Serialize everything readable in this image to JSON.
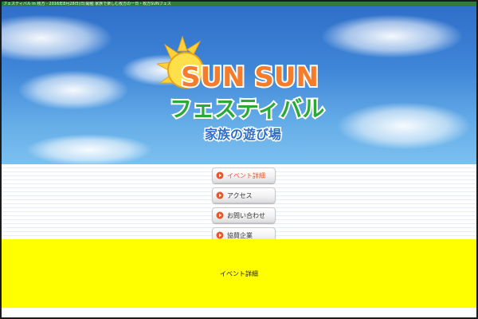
{
  "window": {
    "title": "フェスティバル in 枚方 - 2016年8月28日(日)開催 家族で楽しむ枚方の一日・枚方SUNフェス"
  },
  "logo": {
    "top_text": "SUN SUN",
    "middle_text": "フェスティバル",
    "bottom_text": "家族の遊び場"
  },
  "nav": {
    "items": [
      {
        "label": "イベント詳細",
        "active": true
      },
      {
        "label": "アクセス",
        "active": false
      },
      {
        "label": "お問い合わせ",
        "active": false
      },
      {
        "label": "協賛企業",
        "active": false
      }
    ]
  },
  "content": {
    "heading": "イベント詳細"
  },
  "colors": {
    "sky": "#3f86d8",
    "content_bg": "#ffff00",
    "accent": "#e8552b",
    "logo_green": "#2aa838"
  }
}
